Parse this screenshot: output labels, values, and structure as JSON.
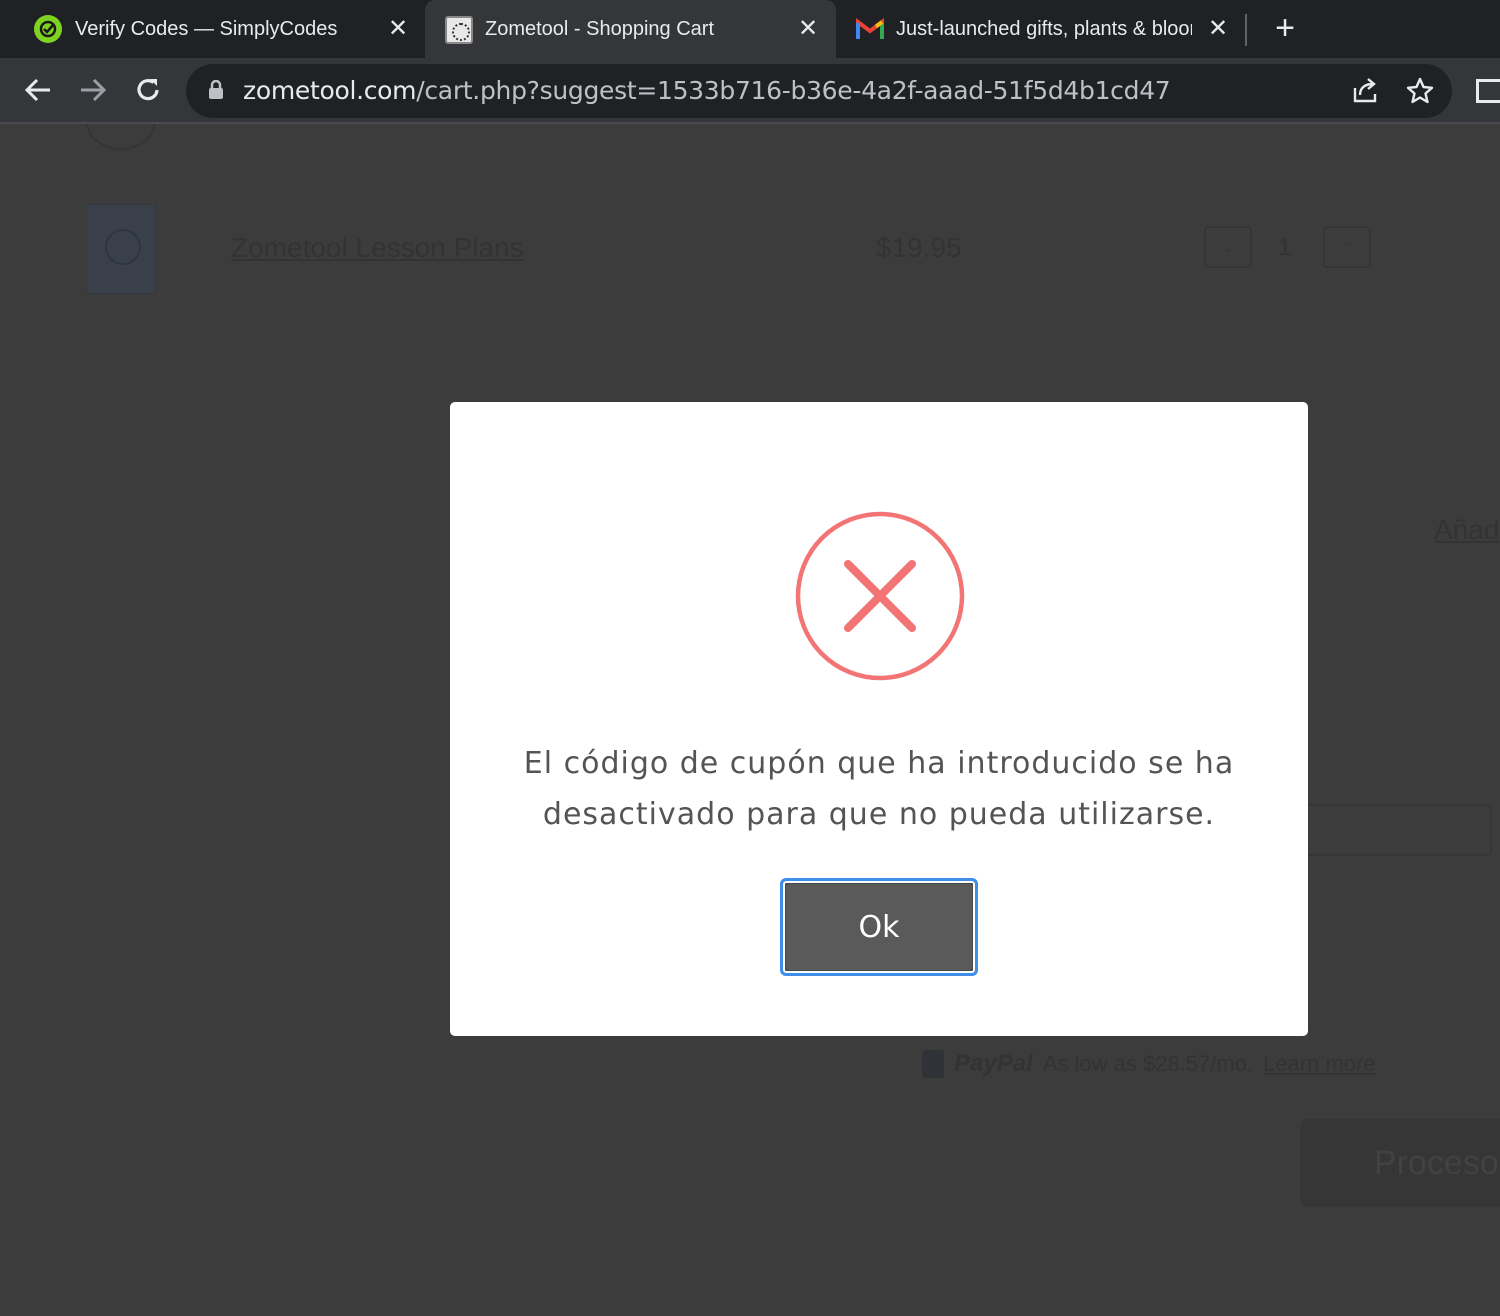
{
  "browser": {
    "tabs": [
      {
        "title": "Verify Codes — SimplyCodes",
        "icon": "simplycodes-icon",
        "active": false
      },
      {
        "title": "Zometool - Shopping Cart",
        "icon": "zometool-icon",
        "active": true
      },
      {
        "title": "Just-launched gifts, plants & blooms",
        "icon": "gmail-icon",
        "active": false
      }
    ],
    "url_domain": "zometool.com",
    "url_path": "/cart.php?suggest=1533b716-b36e-4a2f-aaad-51f5d4b1cd47"
  },
  "cart": {
    "product_name": "Zometool Lesson Plans",
    "product_price": "$19.95",
    "quantity": "1",
    "add_link": "Añad",
    "paypal": {
      "logo": "PayPal",
      "text": "As low as $28.57/mo.",
      "learn_more": "Learn more"
    },
    "checkout_label": "Proceso"
  },
  "modal": {
    "icon": "error-x-icon",
    "message": "El código de cupón que ha introducido se ha desactivado para que no pueda utilizarse.",
    "ok_label": "Ok"
  },
  "colors": {
    "error_icon": "#f27474",
    "ok_focus_ring": "#3f8ee8",
    "overlay": "#3c3c3c"
  }
}
